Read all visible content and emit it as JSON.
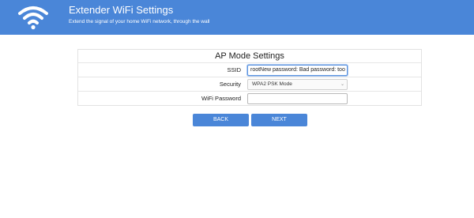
{
  "header": {
    "title": "Extender WiFi Settings",
    "subtitle": "Extend the signal of your home WiFi network, through the wall",
    "icon": "wifi-icon"
  },
  "form": {
    "title": "AP Mode Settings",
    "ssid_label": "SSID",
    "ssid_value": "rootNew password: Bad password: too",
    "security_label": "Security",
    "security_value": "WPA2 PSK Mode",
    "password_label": "WiFi Password",
    "password_value": ""
  },
  "buttons": {
    "back": "BACK",
    "next": "NEXT"
  },
  "colors": {
    "brand": "#4a86d8"
  }
}
